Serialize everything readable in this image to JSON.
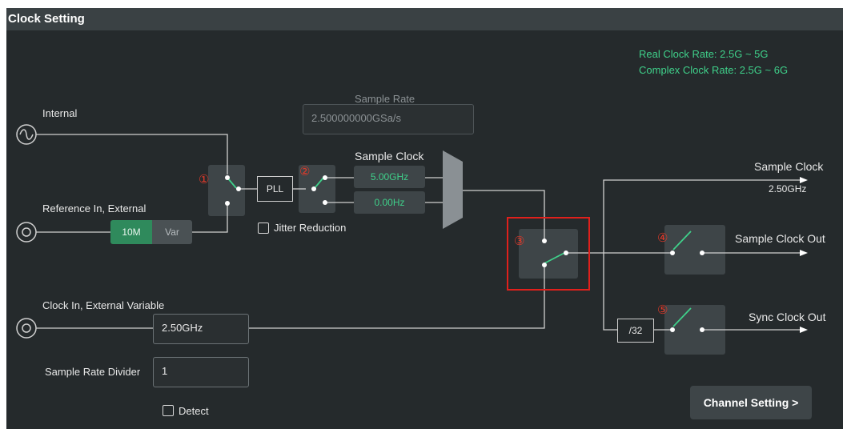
{
  "window": {
    "title": "Clock Setting"
  },
  "info": {
    "real_clock_rate": "Real Clock Rate: 2.5G ~ 5G",
    "complex_clock_rate": "Complex Clock Rate: 2.5G ~ 6G"
  },
  "inputs": {
    "internal_label": "Internal",
    "reference_label": "Reference In, External",
    "reference_options": {
      "opt1": "10M",
      "opt2": "Var",
      "selected": "10M"
    },
    "clock_in_label": "Clock In, External Variable",
    "clock_in_value": "2.50GHz",
    "sample_rate_divider_label": "Sample Rate Divider",
    "sample_rate_divider_value": "1",
    "detect_label": "Detect"
  },
  "sample_rate": {
    "label": "Sample Rate",
    "value": "2.500000000GSa/s"
  },
  "pll": {
    "label": "PLL",
    "jitter_label": "Jitter Reduction"
  },
  "sample_clock": {
    "label": "Sample Clock",
    "value1": "5.00GHz",
    "value2": "0.00Hz"
  },
  "divider": {
    "label": "/32"
  },
  "outputs": {
    "sample_clock_label": "Sample Clock",
    "sample_clock_value": "2.50GHz",
    "sample_clock_out_label": "Sample Clock Out",
    "sync_clock_out_label": "Sync Clock Out"
  },
  "markers": {
    "m1": "①",
    "m2": "②",
    "m3": "③",
    "m4": "④",
    "m5": "⑤"
  },
  "channel_button": {
    "label": "Channel Setting >"
  },
  "colors": {
    "accent": "#3fd08a",
    "highlight": "#e0201c",
    "selected_segment": "#2f8a5c"
  }
}
